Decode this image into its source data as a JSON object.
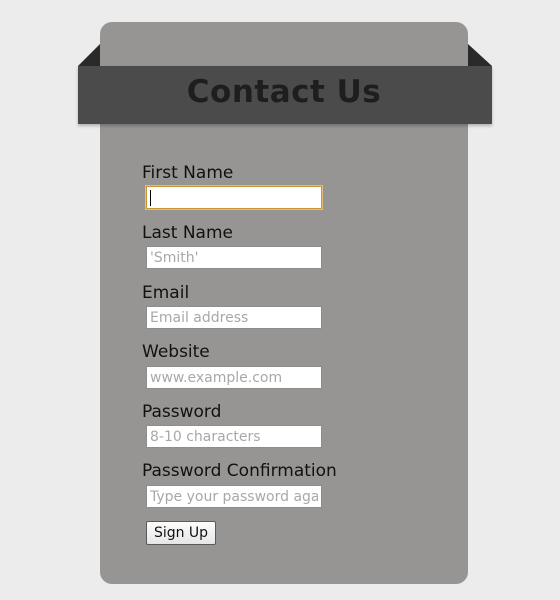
{
  "form": {
    "title": "Contact Us",
    "fields": [
      {
        "label": "First Name",
        "value": "",
        "placeholder": ""
      },
      {
        "label": "Last Name",
        "value": "",
        "placeholder": "'Smith'"
      },
      {
        "label": "Email",
        "value": "",
        "placeholder": "Email address"
      },
      {
        "label": "Website",
        "value": "",
        "placeholder": "www.example.com"
      },
      {
        "label": "Password",
        "value": "",
        "placeholder": "8-10 characters"
      },
      {
        "label": "Password Confirmation",
        "value": "",
        "placeholder": "Type your password again"
      }
    ],
    "submit_label": "Sign Up"
  },
  "colors": {
    "page_background": "#ececec",
    "card_background": "#969594",
    "banner_background": "#4b4b4b",
    "focus_border": "#c9962f"
  }
}
